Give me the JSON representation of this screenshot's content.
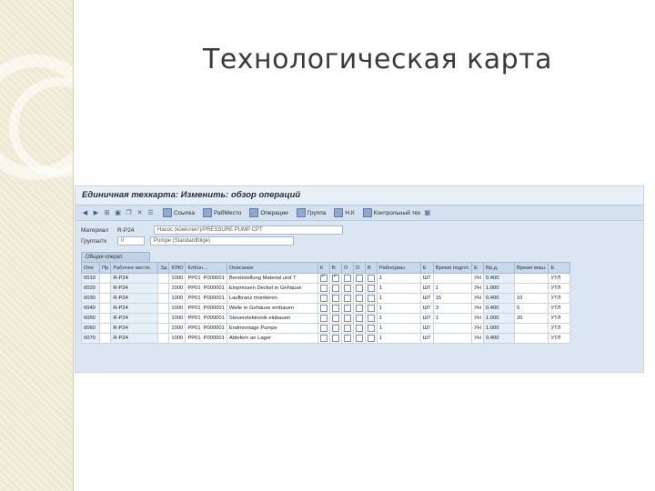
{
  "slide": {
    "title": "Технологическая карта"
  },
  "window": {
    "title": "Единичная техкарта: Изменить: обзор операций"
  },
  "toolbar": {
    "buttons": [
      {
        "label": "Ссылка"
      },
      {
        "label": "РабМесто"
      },
      {
        "label": "Операции"
      },
      {
        "label": "Группа"
      },
      {
        "label": "Н.К"
      },
      {
        "label": "Контрольный тех"
      }
    ]
  },
  "header": {
    "material_label": "Материал",
    "material_value": "R-P24",
    "material_desc": "Насос (комплект)/PRESSURE PUMP CPT",
    "group_label": "Группа/тк",
    "group_value": "0",
    "group_desc": "Pumpe (Standardfolge)"
  },
  "sequence_tab": {
    "label": "Общая операт."
  },
  "grid": {
    "columns": [
      "Опе",
      "Пр",
      "Рабочее место",
      "Зд",
      "КЛЮ",
      "КлКон…",
      "Описание",
      "К",
      "В",
      "О",
      "О",
      "В",
      "Рабнормы",
      "Е",
      "Время подгот.",
      "Е",
      "Вр.д.",
      "Время маш.",
      "Е"
    ],
    "rows": [
      {
        "op": "0010",
        "wc": "R-P24",
        "plant": "1000",
        "ctrl": "PP01",
        "key": "P000001",
        "desc": "Bereitstellung Material und T",
        "c1": true,
        "c2": true,
        "qty": "1",
        "unit": "ШТ",
        "setup": "",
        "u2": "УН",
        "vr": "0.400",
        "mach": "",
        "u3": "УТЛ"
      },
      {
        "op": "0020",
        "wc": "R-P24",
        "plant": "1000",
        "ctrl": "PP01",
        "key": "P000001",
        "desc": "Einpressen Deckel in Gehäuse",
        "c1": false,
        "c2": false,
        "qty": "1",
        "unit": "ШТ",
        "setup": "1",
        "u2": "УН",
        "vr": "1.000",
        "mach": "",
        "u3": "УТЛ"
      },
      {
        "op": "0030",
        "wc": "R-P24",
        "plant": "1000",
        "ctrl": "PP01",
        "key": "P000001",
        "desc": "Laufkranz montieren",
        "c1": false,
        "c2": false,
        "qty": "1",
        "unit": "ШТ",
        "setup": "15",
        "u2": "УН",
        "vr": "0.400",
        "mach": "10",
        "u3": "УТЛ"
      },
      {
        "op": "0040",
        "wc": "R-P24",
        "plant": "1000",
        "ctrl": "PP01",
        "key": "P000001",
        "desc": "Welle in Gehäuse einbauen",
        "c1": false,
        "c2": false,
        "qty": "1",
        "unit": "ШТ",
        "setup": "3",
        "u2": "УН",
        "vr": "0.400",
        "mach": "5",
        "u3": "УТЛ"
      },
      {
        "op": "0050",
        "wc": "R-P24",
        "plant": "1000",
        "ctrl": "PP01",
        "key": "P000001",
        "desc": "Steuerelektronik einbauen",
        "c1": false,
        "c2": false,
        "qty": "1",
        "unit": "ШТ",
        "setup": "1",
        "u2": "УН",
        "vr": "1.000",
        "mach": "20",
        "u3": "УТЛ"
      },
      {
        "op": "0060",
        "wc": "R-P24",
        "plant": "1000",
        "ctrl": "PP01",
        "key": "P000001",
        "desc": "Endmontage Pumpe",
        "c1": false,
        "c2": false,
        "qty": "1",
        "unit": "ШТ",
        "setup": "",
        "u2": "УН",
        "vr": "1.000",
        "mach": "",
        "u3": "УТЛ"
      },
      {
        "op": "0070",
        "wc": "R-P24",
        "plant": "1000",
        "ctrl": "PP01",
        "key": "P000001",
        "desc": "Ablefern an Lager",
        "c1": false,
        "c2": false,
        "qty": "1",
        "unit": "ШТ",
        "setup": "",
        "u2": "УН",
        "vr": "0.400",
        "mach": "",
        "u3": "УТЛ"
      }
    ]
  }
}
